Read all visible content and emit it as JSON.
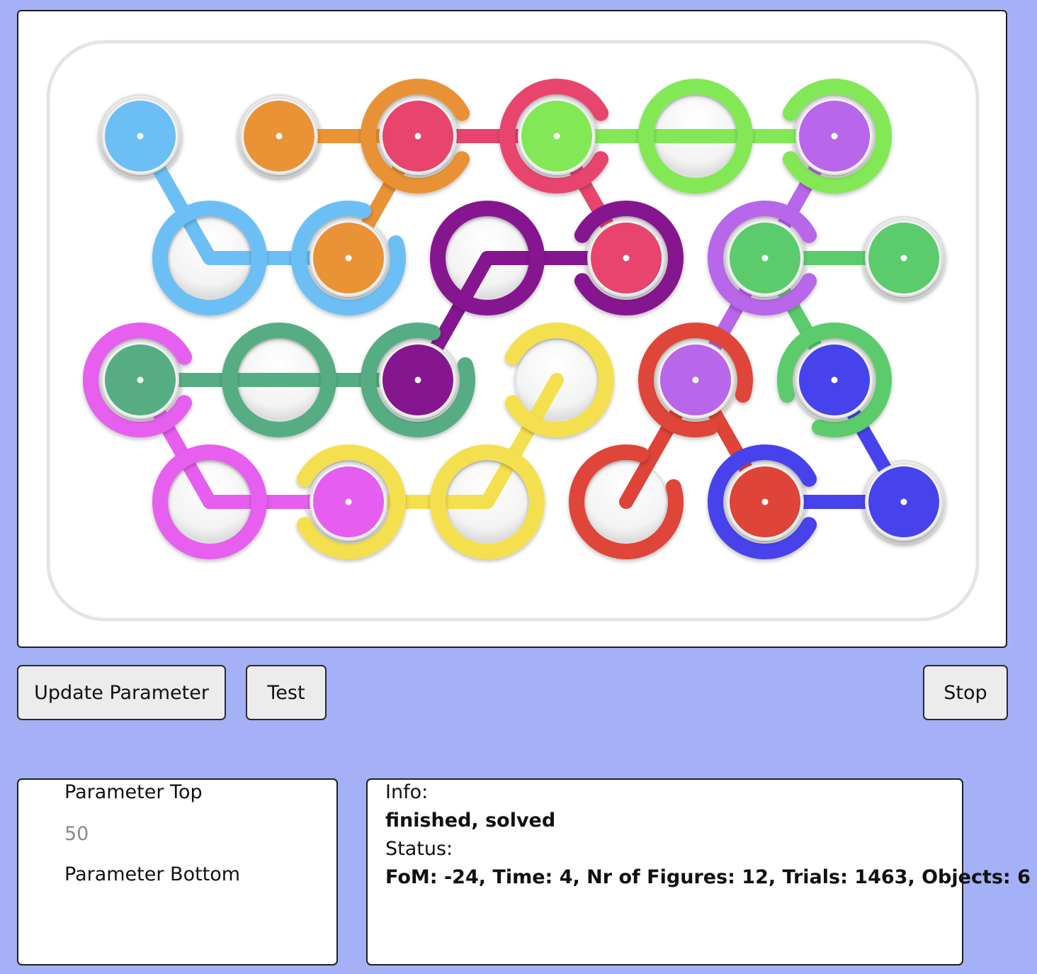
{
  "puzzle": {
    "colors": {
      "light_blue": "#6cbff4",
      "orange": "#e99236",
      "pink_red": "#e8446e",
      "light_green": "#82e856",
      "violet": "#b866ea",
      "purple": "#86168f",
      "green": "#5ccb6c",
      "teal": "#56ad84",
      "magenta": "#e65eef",
      "yellow": "#f4e04f",
      "red": "#df4438",
      "blue": "#4743ec"
    },
    "pieces": [
      {
        "color": "light_blue",
        "kind": "dot",
        "row": 0,
        "col": 0
      },
      {
        "color": "orange",
        "kind": "dot",
        "row": 0,
        "col": 1
      },
      {
        "color": "pink_red",
        "kind": "dot",
        "row": 0,
        "col": 2
      },
      {
        "color": "orange",
        "kind": "ring",
        "row": 0,
        "col": 2,
        "gap": "right"
      },
      {
        "color": "light_green",
        "kind": "dot",
        "row": 0,
        "col": 3
      },
      {
        "color": "pink_red",
        "kind": "ring",
        "row": 0,
        "col": 3,
        "gap": "right"
      },
      {
        "color": "light_green",
        "kind": "ring",
        "row": 0,
        "col": 4,
        "gap": "none"
      },
      {
        "color": "violet",
        "kind": "dot",
        "row": 0,
        "col": 5
      },
      {
        "color": "light_green",
        "kind": "ring",
        "row": 0,
        "col": 5,
        "gap": "left"
      },
      {
        "color": "light_blue",
        "kind": "ring",
        "row": 1,
        "col": 0,
        "gap": "none"
      },
      {
        "color": "orange",
        "kind": "dot",
        "row": 1,
        "col": 1
      },
      {
        "color": "light_blue",
        "kind": "ring",
        "row": 1,
        "col": 1,
        "gap": "top-right"
      },
      {
        "color": "purple",
        "kind": "ring",
        "row": 1,
        "col": 2,
        "gap": "none"
      },
      {
        "color": "pink_red",
        "kind": "dot",
        "row": 1,
        "col": 3
      },
      {
        "color": "purple",
        "kind": "ring",
        "row": 1,
        "col": 3,
        "gap": "left"
      },
      {
        "color": "green",
        "kind": "dot",
        "row": 1,
        "col": 4
      },
      {
        "color": "violet",
        "kind": "ring",
        "row": 1,
        "col": 4,
        "gap": "right"
      },
      {
        "color": "green",
        "kind": "dot",
        "row": 1,
        "col": 5
      },
      {
        "color": "teal",
        "kind": "dot",
        "row": 2,
        "col": 0
      },
      {
        "color": "magenta",
        "kind": "ring",
        "row": 2,
        "col": 0,
        "gap": "right"
      },
      {
        "color": "teal",
        "kind": "ring",
        "row": 2,
        "col": 1,
        "gap": "none"
      },
      {
        "color": "purple",
        "kind": "dot",
        "row": 2,
        "col": 2
      },
      {
        "color": "teal",
        "kind": "ring",
        "row": 2,
        "col": 2,
        "gap": "top-right"
      },
      {
        "color": "yellow",
        "kind": "ring",
        "row": 2,
        "col": 3,
        "gap": "left"
      },
      {
        "color": "violet",
        "kind": "dot",
        "row": 2,
        "col": 4
      },
      {
        "color": "red",
        "kind": "ring",
        "row": 2,
        "col": 4,
        "gap": "bottom-right"
      },
      {
        "color": "blue",
        "kind": "dot",
        "row": 2,
        "col": 5
      },
      {
        "color": "green",
        "kind": "ring",
        "row": 2,
        "col": 5,
        "gap": "bottom-left"
      },
      {
        "color": "magenta",
        "kind": "ring",
        "row": 3,
        "col": 0,
        "gap": "none"
      },
      {
        "color": "magenta",
        "kind": "dot",
        "row": 3,
        "col": 1
      },
      {
        "color": "yellow",
        "kind": "ring",
        "row": 3,
        "col": 1,
        "gap": "left"
      },
      {
        "color": "yellow",
        "kind": "ring",
        "row": 3,
        "col": 2,
        "gap": "none"
      },
      {
        "color": "red",
        "kind": "ring",
        "row": 3,
        "col": 3,
        "gap": "top-right"
      },
      {
        "color": "red",
        "kind": "dot",
        "row": 3,
        "col": 4
      },
      {
        "color": "blue",
        "kind": "ring",
        "row": 3,
        "col": 4,
        "gap": "right"
      },
      {
        "color": "blue",
        "kind": "dot",
        "row": 3,
        "col": 5
      }
    ],
    "links": [
      {
        "color": "light_blue",
        "from": [
          0,
          0
        ],
        "to": [
          1,
          0
        ]
      },
      {
        "color": "light_blue",
        "from": [
          1,
          0
        ],
        "to": [
          1,
          1
        ]
      },
      {
        "color": "orange",
        "from": [
          0,
          1
        ],
        "to": [
          0,
          2
        ]
      },
      {
        "color": "orange",
        "from": [
          0,
          2
        ],
        "to": [
          1,
          1
        ]
      },
      {
        "color": "pink_red",
        "from": [
          0,
          2
        ],
        "to": [
          0,
          3
        ]
      },
      {
        "color": "pink_red",
        "from": [
          0,
          3
        ],
        "to": [
          1,
          3
        ]
      },
      {
        "color": "light_green",
        "from": [
          0,
          3
        ],
        "to": [
          0,
          4
        ]
      },
      {
        "color": "light_green",
        "from": [
          0,
          4
        ],
        "to": [
          0,
          5
        ]
      },
      {
        "color": "violet",
        "from": [
          0,
          5
        ],
        "to": [
          1,
          4
        ]
      },
      {
        "color": "violet",
        "from": [
          1,
          4
        ],
        "to": [
          2,
          4
        ]
      },
      {
        "color": "purple",
        "from": [
          1,
          2
        ],
        "to": [
          1,
          3
        ]
      },
      {
        "color": "purple",
        "from": [
          1,
          2
        ],
        "to": [
          2,
          2
        ]
      },
      {
        "color": "green",
        "from": [
          1,
          4
        ],
        "to": [
          1,
          5
        ]
      },
      {
        "color": "green",
        "from": [
          1,
          4
        ],
        "to": [
          2,
          5
        ]
      },
      {
        "color": "teal",
        "from": [
          2,
          0
        ],
        "to": [
          2,
          1
        ]
      },
      {
        "color": "teal",
        "from": [
          2,
          1
        ],
        "to": [
          2,
          2
        ]
      },
      {
        "color": "magenta",
        "from": [
          2,
          0
        ],
        "to": [
          3,
          0
        ]
      },
      {
        "color": "magenta",
        "from": [
          3,
          0
        ],
        "to": [
          3,
          1
        ]
      },
      {
        "color": "yellow",
        "from": [
          2,
          3
        ],
        "to": [
          3,
          2
        ]
      },
      {
        "color": "yellow",
        "from": [
          3,
          1
        ],
        "to": [
          3,
          2
        ]
      },
      {
        "color": "red",
        "from": [
          2,
          4
        ],
        "to": [
          3,
          3
        ]
      },
      {
        "color": "red",
        "from": [
          2,
          4
        ],
        "to": [
          3,
          4
        ]
      },
      {
        "color": "blue",
        "from": [
          2,
          5
        ],
        "to": [
          3,
          5
        ]
      },
      {
        "color": "blue",
        "from": [
          3,
          4
        ],
        "to": [
          3,
          5
        ]
      }
    ]
  },
  "buttons": {
    "update": "Update Parameter",
    "test": "Test",
    "stop": "Stop"
  },
  "parameters": {
    "top_label": "Parameter Top",
    "top_placeholder": "50",
    "bottom_label": "Parameter Bottom"
  },
  "info": {
    "info_label": "Info:",
    "info_text": "finished, solved",
    "status_label": "Status:",
    "status_text": "FoM: -24, Time: 4, Nr of Figures: 12, Trials: 1463, Objects: 6"
  }
}
